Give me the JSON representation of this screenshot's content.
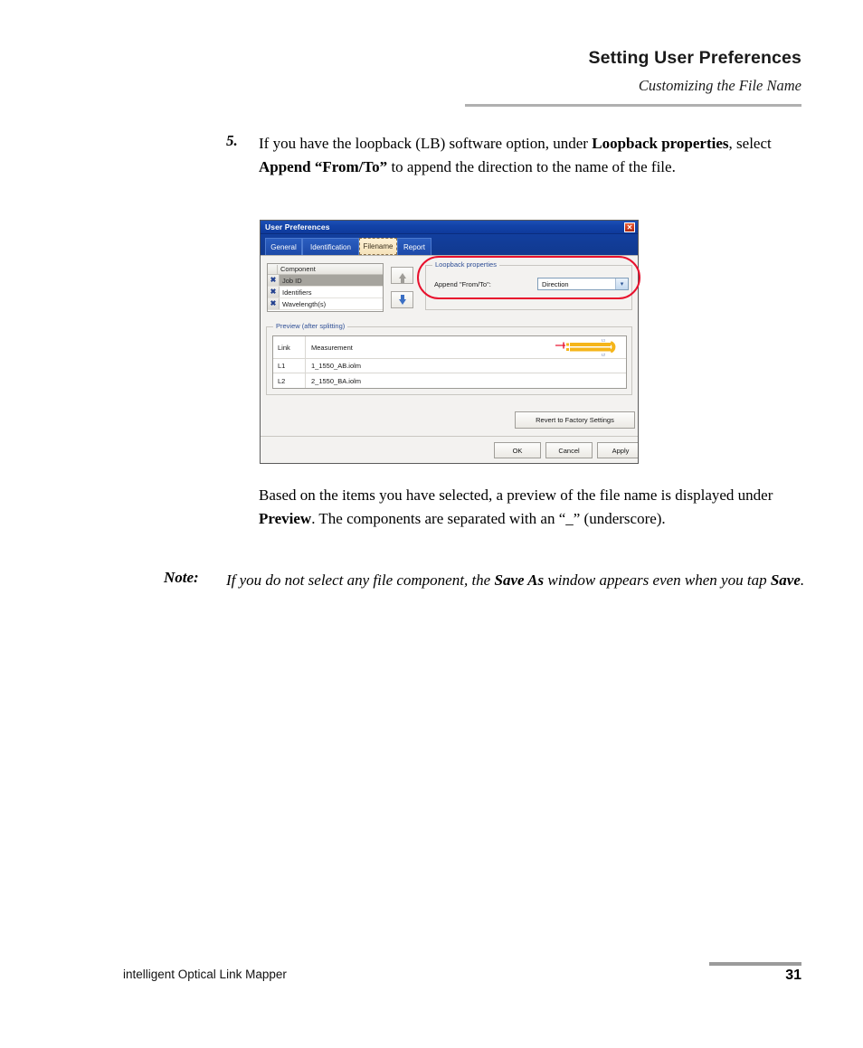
{
  "header": {
    "title": "Setting User Preferences",
    "subtitle": "Customizing the File Name"
  },
  "step": {
    "number": "5.",
    "text_parts": [
      "If you have the loopback (LB) software option, under ",
      "Loopback properties",
      ", select ",
      "Append “From/To”",
      " to append the direction to the name of the file."
    ]
  },
  "paragraph": {
    "parts": [
      "Based on the items you have selected, a preview of the file name is displayed under ",
      "Preview",
      ". The components are separated with an “_” (underscore)."
    ]
  },
  "note": {
    "label": "Note:",
    "parts": [
      "If you do not select any file component, the ",
      "Save As",
      " window appears even when you tap ",
      "Save",
      "."
    ]
  },
  "footer": {
    "product": "intelligent Optical Link Mapper",
    "page_number": "31"
  },
  "dialog": {
    "title": "User Preferences",
    "close_icon": "close-icon",
    "close_glyph": "✕",
    "tabs": [
      {
        "label": "General",
        "active": false
      },
      {
        "label": "Identification",
        "active": false
      },
      {
        "label": "Filename",
        "active": true
      },
      {
        "label": "Report",
        "active": false
      }
    ],
    "component_list": {
      "header": "Component",
      "rows": [
        {
          "mark": "✖",
          "label": "Job ID",
          "selected": true
        },
        {
          "mark": "✖",
          "label": "Identifiers",
          "selected": false
        },
        {
          "mark": "✖",
          "label": "Wavelength(s)",
          "selected": false
        }
      ]
    },
    "order_buttons": {
      "up_icon": "arrow-up-icon",
      "down_icon": "arrow-down-icon"
    },
    "loopback_group": {
      "title": "Loopback properties",
      "field_label": "Append \"From/To\":",
      "dropdown_value": "Direction",
      "dropdown_arrow": "▾"
    },
    "preview_group": {
      "title": "Preview (after splitting)",
      "columns": [
        "Link",
        "Measurement"
      ],
      "rows": [
        {
          "link": "L1",
          "measurement": "1_1550_AB.iolm"
        },
        {
          "link": "L2",
          "measurement": "2_1550_BA.iolm"
        }
      ],
      "diagram": {
        "name": "loopback-diagram-icon",
        "top_label": "L1",
        "bottom_label": "L2"
      }
    },
    "buttons": {
      "revert": "Revert to Factory Settings",
      "ok": "OK",
      "cancel": "Cancel",
      "apply": "Apply"
    }
  },
  "annotation": {
    "name": "red-highlight-oval",
    "color": "#e8112d"
  },
  "colors": {
    "titlebar_blue": "#1343a8",
    "tab_strip_blue": "#123f9e",
    "active_tab_cream": "#fdf0d4",
    "group_title_blue": "#2f4f96",
    "diagram_orange": "#f5b51a",
    "diagram_red": "#e8112d",
    "rule_gray": "#b0b0b0"
  }
}
